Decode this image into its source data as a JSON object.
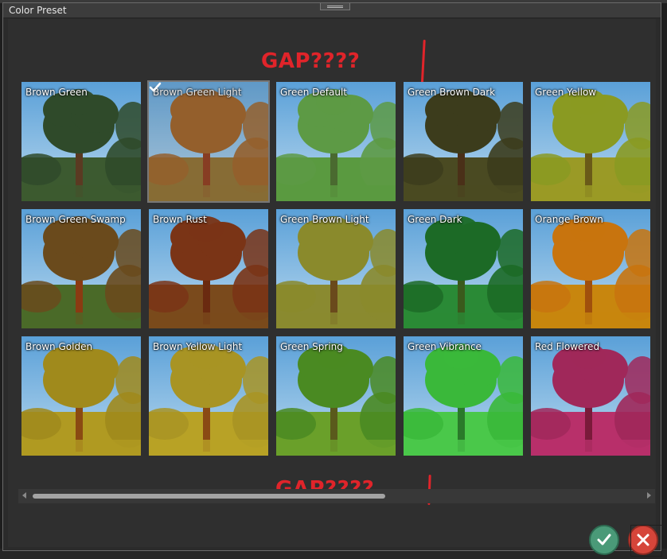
{
  "window": {
    "title": "Color Preset"
  },
  "annotations": {
    "top": "GAP????",
    "bottom": "GAP????"
  },
  "presets": [
    {
      "label": "Brown Green",
      "foliage": "#2f4a2a",
      "trunk": "#5a3a22",
      "ground": "#3c5a30",
      "selected": false
    },
    {
      "label": "Brown Green Light",
      "foliage": "#9a5a1c",
      "trunk": "#8a3010",
      "ground": "#8a6a26",
      "selected": true
    },
    {
      "label": "Green Default",
      "foliage": "#5d9a45",
      "trunk": "#4a6a30",
      "ground": "#5a9a40",
      "selected": false
    },
    {
      "label": "Green Brown Dark",
      "foliage": "#3c3c1c",
      "trunk": "#4a3018",
      "ground": "#4a4a22",
      "selected": false
    },
    {
      "label": "Green Yellow",
      "foliage": "#8a9a22",
      "trunk": "#6a5a18",
      "ground": "#9a9a26",
      "selected": false
    },
    {
      "label": "Brown Green Swamp",
      "foliage": "#6a4a1c",
      "trunk": "#8a3a12",
      "ground": "#4a6a28",
      "selected": false
    },
    {
      "label": "Brown Rust",
      "foliage": "#7a3416",
      "trunk": "#6a2a10",
      "ground": "#7a4a1c",
      "selected": false
    },
    {
      "label": "Green Brown Light",
      "foliage": "#8a8a2c",
      "trunk": "#6a4a1c",
      "ground": "#8a8a30",
      "selected": false
    },
    {
      "label": "Green Dark",
      "foliage": "#1c6a26",
      "trunk": "#3a5a1c",
      "ground": "#2a8a36",
      "selected": false
    },
    {
      "label": "Orange Brown",
      "foliage": "#c8740e",
      "trunk": "#a0500c",
      "ground": "#c8860e",
      "selected": false
    },
    {
      "label": "Brown Golden",
      "foliage": "#a08a1c",
      "trunk": "#8a4a12",
      "ground": "#b09a22",
      "selected": false
    },
    {
      "label": "Brown Yellow Light",
      "foliage": "#a89424",
      "trunk": "#8a4a14",
      "ground": "#b8a226",
      "selected": false
    },
    {
      "label": "Green Spring",
      "foliage": "#4a8a22",
      "trunk": "#5a5a1c",
      "ground": "#6aa02a",
      "selected": false
    },
    {
      "label": "Green Vibrance",
      "foliage": "#3ab83a",
      "trunk": "#2a7a2a",
      "ground": "#4ac84a",
      "selected": false
    },
    {
      "label": "Red Flowered",
      "foliage": "#a0285a",
      "trunk": "#7a1a3a",
      "ground": "#b8306a",
      "selected": false
    }
  ],
  "scroll": {
    "thumb_fraction": 0.58
  },
  "icons": {
    "confirm": "check-icon",
    "cancel": "close-icon",
    "selected_mark": "check-icon"
  },
  "colors": {
    "sky_top": "#5aa0d8",
    "sky_bottom": "#b8d8ee",
    "confirm": "#4a9a78",
    "cancel": "#d6453a"
  }
}
